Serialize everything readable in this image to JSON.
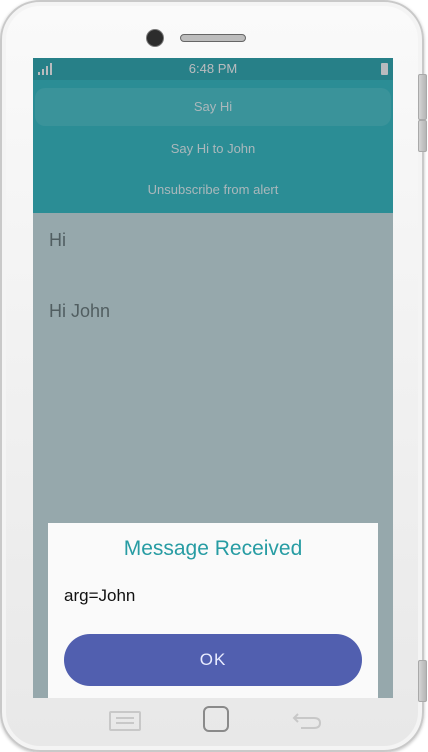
{
  "status_bar": {
    "time": "6:48 PM"
  },
  "header": {
    "items": [
      {
        "label": "Say Hi"
      },
      {
        "label": "Say Hi to John"
      },
      {
        "label": "Unsubscribe from alert"
      }
    ]
  },
  "content": {
    "items": [
      {
        "text": "Hi"
      },
      {
        "text": "Hi John"
      }
    ]
  },
  "dialog": {
    "title": "Message Received",
    "message": "arg=John",
    "ok_label": "OK"
  },
  "nav_bar": {
    "icons": [
      "menu-icon",
      "home-icon",
      "back-icon"
    ]
  },
  "colors": {
    "accent": "#25b9c0",
    "status_bar": "#1fa5ac",
    "dialog_title": "#279ca3",
    "dialog_button": "#515faf"
  }
}
